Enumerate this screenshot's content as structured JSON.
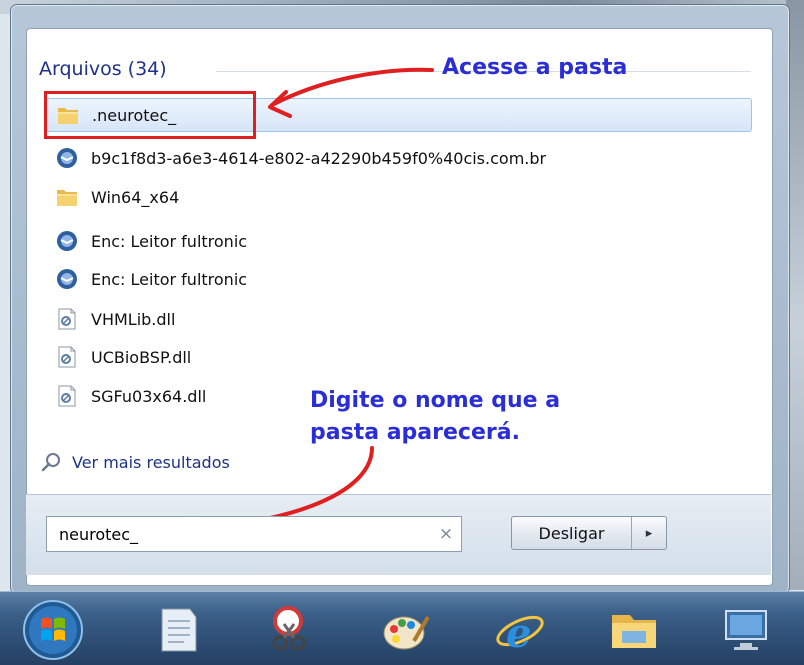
{
  "results": {
    "group_header": "Arquivos (34)",
    "items": [
      {
        "label": ".neurotec_",
        "icon": "folder-icon",
        "selected": true
      },
      {
        "label": "b9c1f8d3-a6e3-4614-e802-a42290b459f0%40cis.com.br",
        "icon": "mail-item-icon",
        "selected": false
      },
      {
        "label": "Win64_x64",
        "icon": "folder-icon",
        "selected": false
      },
      {
        "label": "Enc: Leitor fultronic",
        "icon": "mail-item-icon",
        "selected": false
      },
      {
        "label": "Enc: Leitor fultronic",
        "icon": "mail-item-icon",
        "selected": false
      },
      {
        "label": "VHMLib.dll",
        "icon": "dll-file-icon",
        "selected": false
      },
      {
        "label": "UCBioBSP.dll",
        "icon": "dll-file-icon",
        "selected": false
      },
      {
        "label": "SGFu03x64.dll",
        "icon": "dll-file-icon",
        "selected": false
      }
    ],
    "see_more": "Ver mais resultados"
  },
  "search": {
    "value": "neurotec_",
    "clear_glyph": "×"
  },
  "shutdown": {
    "label": "Desligar",
    "arrow_glyph": "▸"
  },
  "annotations": {
    "folder_hint": "Acesse a pasta",
    "search_hint_line1": "Digite o nome que a",
    "search_hint_line2": "pasta aparecerá."
  },
  "colors": {
    "annotation": "#2a2ed4",
    "highlight_box": "#e02020",
    "arrow": "#e02020",
    "header_text": "#1e3287"
  },
  "taskbar": {
    "icons": [
      "start-orb-icon",
      "notepad-icon",
      "snipping-tool-icon",
      "paint-icon",
      "internet-explorer-icon",
      "file-explorer-icon",
      "remote-desktop-icon"
    ]
  }
}
